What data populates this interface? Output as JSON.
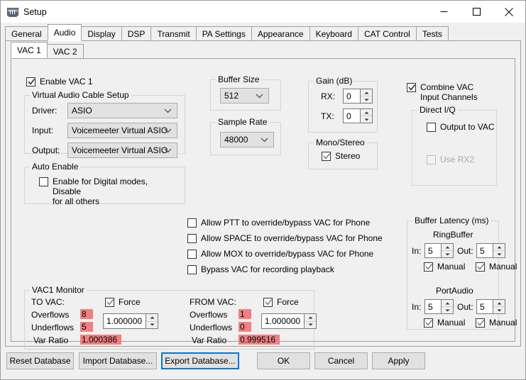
{
  "window": {
    "title": "Setup",
    "icon": "radio-setup-icon",
    "minimize": "minimize-icon",
    "maximize": "maximize-icon",
    "close": "close-icon"
  },
  "tabs": [
    {
      "label": "General",
      "selected": false
    },
    {
      "label": "Audio",
      "selected": true
    },
    {
      "label": "Display",
      "selected": false
    },
    {
      "label": "DSP",
      "selected": false
    },
    {
      "label": "Transmit",
      "selected": false
    },
    {
      "label": "PA Settings",
      "selected": false
    },
    {
      "label": "Appearance",
      "selected": false
    },
    {
      "label": "Keyboard",
      "selected": false
    },
    {
      "label": "CAT Control",
      "selected": false
    },
    {
      "label": "Tests",
      "selected": false
    }
  ],
  "subtabs": [
    {
      "label": "VAC 1",
      "selected": true
    },
    {
      "label": "VAC 2",
      "selected": false
    }
  ],
  "enable_vac": {
    "label": "Enable VAC 1",
    "checked": true
  },
  "vac_setup": {
    "title": "Virtual Audio Cable Setup",
    "driver_label": "Driver:",
    "driver_value": "ASIO",
    "input_label": "Input:",
    "input_value": "Voicemeeter Virtual ASIO",
    "output_label": "Output:",
    "output_value": "Voicemeeter Virtual ASIO"
  },
  "auto_enable": {
    "title": "Auto Enable",
    "checkbox_label": "Enable for Digital modes, Disable\nfor all others",
    "checked": false
  },
  "buffer_size": {
    "title": "Buffer Size",
    "value": "512"
  },
  "sample_rate": {
    "title": "Sample Rate",
    "value": "48000"
  },
  "gain": {
    "title": "Gain (dB)",
    "rx_label": "RX:",
    "rx_value": "0",
    "tx_label": "TX:",
    "tx_value": "0"
  },
  "mono_stereo": {
    "title": "Mono/Stereo",
    "stereo_label": "Stereo",
    "stereo_checked": true
  },
  "combine": {
    "label": "Combine VAC\nInput Channels",
    "checked": true
  },
  "direct_iq": {
    "title": "Direct I/Q",
    "output_label": "Output to VAC",
    "output_checked": false,
    "rx2_label": "Use RX2",
    "rx2_checked": false,
    "rx2_disabled": true
  },
  "overrides": [
    {
      "label": "Allow PTT to override/bypass VAC for Phone",
      "checked": false
    },
    {
      "label": "Allow SPACE to override/bypass VAC for Phone",
      "checked": false
    },
    {
      "label": "Allow MOX to override/bypass VAC for Phone",
      "checked": false
    },
    {
      "label": "Bypass VAC for recording playback",
      "checked": false
    }
  ],
  "buffer_latency": {
    "title": "Buffer Latency (ms)",
    "ring_title": "RingBuffer",
    "port_title": "PortAudio",
    "in_label": "In:",
    "out_label": "Out:",
    "manual_label": "Manual",
    "ring_in": "5",
    "ring_out": "5",
    "ring_in_manual": true,
    "ring_out_manual": true,
    "port_in": "5",
    "port_out": "5",
    "port_in_manual": true,
    "port_out_manual": true
  },
  "monitor": {
    "title": "VAC1 Monitor",
    "to_vac": {
      "header": "TO VAC:",
      "overflows_label": "Overflows",
      "overflows_value": "8",
      "underflows_label": "Underflows",
      "underflows_value": "5",
      "var_ratio_label": "Var Ratio",
      "var_ratio_value": "1.000386",
      "force_label": "Force",
      "force_checked": true,
      "force_value": "1.000000"
    },
    "from_vac": {
      "header": "FROM VAC:",
      "overflows_label": "Overflows",
      "overflows_value": "1",
      "underflows_label": "Underflows",
      "underflows_value": "0",
      "var_ratio_label": "Var Ratio",
      "var_ratio_value": "0.999516",
      "force_label": "Force",
      "force_checked": true,
      "force_value": "1.000000"
    },
    "highlight_color": "#f08080"
  },
  "buttons": {
    "reset": "Reset Database",
    "import": "Import Database...",
    "export": "Export Database...",
    "ok": "OK",
    "cancel": "Cancel",
    "apply": "Apply",
    "focused": "export"
  }
}
